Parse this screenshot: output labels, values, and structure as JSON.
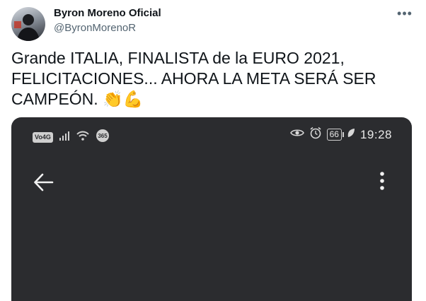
{
  "tweet": {
    "author_name": "Byron Moreno Oficial",
    "author_handle": "@ByronMorenoR",
    "text": "Grande ITALIA, FINALISTA de la EURO 2021, FELICITACIONES... AHORA LA META SERÁ SER CAMPEÓN. 👏💪",
    "more_icon": "more-horizontal-icon"
  },
  "phone_screenshot": {
    "status_bar": {
      "network_badge": "Vo4G",
      "right_badge_text": "365",
      "battery_level": "66",
      "time": "19:28"
    },
    "icons": [
      "back-arrow-icon",
      "more-vertical-icon",
      "eye-icon",
      "alarm-icon",
      "wifi-icon",
      "signal-icon",
      "leaf-icon"
    ],
    "colors": {
      "background": "#2b2c2f",
      "foreground": "#e0e0e0"
    }
  }
}
